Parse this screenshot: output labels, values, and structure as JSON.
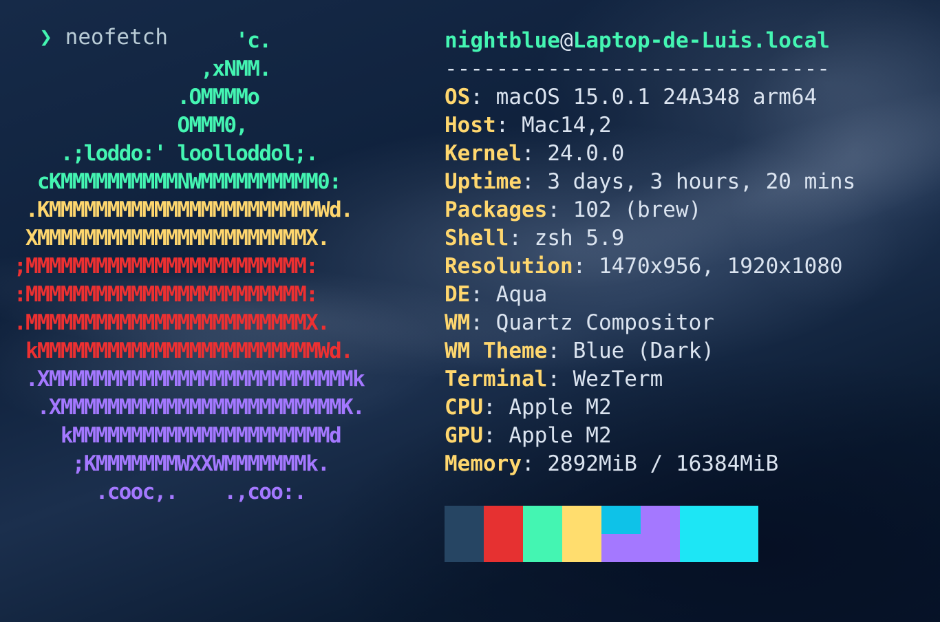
{
  "terminal": {
    "prompt_symbol": "❯",
    "command": "neofetch"
  },
  "logo": {
    "lines": [
      {
        "text": "                   'c.",
        "color": "#44f5b2"
      },
      {
        "text": "                ,xNMM.",
        "color": "#44f5b2"
      },
      {
        "text": "              .OMMMMo",
        "color": "#44f5b2"
      },
      {
        "text": "              OMMM0,",
        "color": "#44f5b2"
      },
      {
        "text": "    .;loddo:' loolloddol;.",
        "color": "#44f5b2"
      },
      {
        "text": "  cKMMMMMMMMMMNWMMMMMMMMMM0:",
        "color": "#44f5b2"
      },
      {
        "text": " .KMMMMMMMMMMMMMMMMMMMMMMMWd.",
        "color": "#ffd76e"
      },
      {
        "text": " XMMMMMMMMMMMMMMMMMMMMMMMX.",
        "color": "#ffd76e"
      },
      {
        "text": ";MMMMMMMMMMMMMMMMMMMMMMMM:",
        "color": "#ed3031"
      },
      {
        "text": ":MMMMMMMMMMMMMMMMMMMMMMMM:",
        "color": "#ed3031"
      },
      {
        "text": ".MMMMMMMMMMMMMMMMMMMMMMMMX.",
        "color": "#ed3031"
      },
      {
        "text": " kMMMMMMMMMMMMMMMMMMMMMMMMWd.",
        "color": "#ed3031"
      },
      {
        "text": " .XMMMMMMMMMMMMMMMMMMMMMMMMMMk",
        "color": "#a478ff"
      },
      {
        "text": "  .XMMMMMMMMMMMMMMMMMMMMMMMMK.",
        "color": "#a478ff"
      },
      {
        "text": "    kMMMMMMMMMMMMMMMMMMMMMMd",
        "color": "#a478ff"
      },
      {
        "text": "     ;KMMMMMMMWXXWMMMMMMMk.",
        "color": "#a478ff"
      },
      {
        "text": "       .cooc,.    .,coo:.",
        "color": "#a478ff"
      }
    ]
  },
  "info": {
    "user": "nightblue",
    "at": "@",
    "host": "Laptop-de-Luis.local",
    "separator": "------------------------------",
    "fields": [
      {
        "key": "OS",
        "value": "macOS 15.0.1 24A348 arm64"
      },
      {
        "key": "Host",
        "value": "Mac14,2"
      },
      {
        "key": "Kernel",
        "value": "24.0.0"
      },
      {
        "key": "Uptime",
        "value": "3 days, 3 hours, 20 mins"
      },
      {
        "key": "Packages",
        "value": "102 (brew)"
      },
      {
        "key": "Shell",
        "value": "zsh 5.9"
      },
      {
        "key": "Resolution",
        "value": "1470x956, 1920x1080"
      },
      {
        "key": "DE",
        "value": "Aqua"
      },
      {
        "key": "WM",
        "value": "Quartz Compositor"
      },
      {
        "key": "WM Theme",
        "value": "Blue (Dark)"
      },
      {
        "key": "Terminal",
        "value": "WezTerm"
      },
      {
        "key": "CPU",
        "value": "Apple M2"
      },
      {
        "key": "GPU",
        "value": "Apple M2"
      },
      {
        "key": "Memory",
        "value": "2892MiB / 16384MiB"
      }
    ]
  },
  "palette": {
    "colors": [
      "#264563",
      "#e63131",
      "#44f5b2",
      "#ffdd6e",
      "#0ec2e8",
      "#a478ff",
      "#a478ff",
      "#1de6f5",
      "#1de6f5"
    ]
  }
}
